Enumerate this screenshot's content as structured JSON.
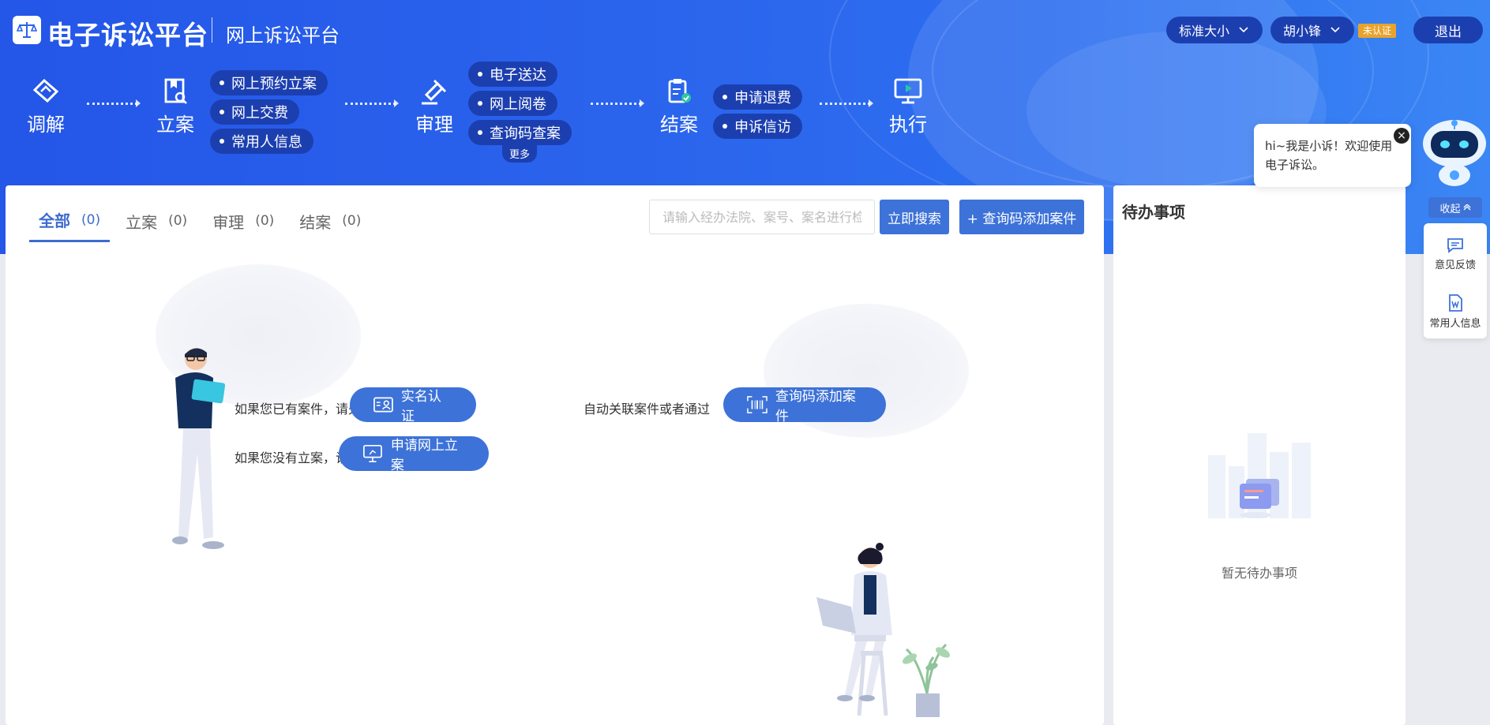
{
  "header": {
    "brand": "电子诉讼平台",
    "subtitle": "网上诉讼平台",
    "font_size_label": "标准大小",
    "user_name": "胡小锋",
    "auth_badge": "未认证",
    "logout_label": "退出"
  },
  "steps": [
    {
      "label": "调解",
      "icon": "handshake-icon"
    },
    {
      "label": "立案",
      "icon": "filing-icon"
    },
    {
      "label": "审理",
      "icon": "gavel-icon"
    },
    {
      "label": "结案",
      "icon": "clipboard-check-icon"
    },
    {
      "label": "执行",
      "icon": "monitor-play-icon"
    }
  ],
  "chips": {
    "filing": [
      "网上预约立案",
      "网上交费",
      "常用人信息"
    ],
    "trial": [
      "电子送达",
      "网上阅卷",
      "查询码查案"
    ],
    "trial_more": "更多",
    "closing": [
      "申请退费",
      "申诉信访"
    ]
  },
  "tabs": [
    {
      "label": "全部",
      "count": "(0)",
      "active": true
    },
    {
      "label": "立案",
      "count": "(0)",
      "active": false
    },
    {
      "label": "审理",
      "count": "(0)",
      "active": false
    },
    {
      "label": "结案",
      "count": "(0)",
      "active": false
    }
  ],
  "search": {
    "placeholder": "请输入经办法院、案号、案名进行检索",
    "button": "立即搜索",
    "add_button": "+ 查询码添加案件"
  },
  "guide": {
    "line1_prefix": "如果您已有案件，请先",
    "realname_button": "实名认证",
    "line1_mid": "自动关联案件或者通过",
    "querycode_button": "查询码添加案件",
    "line2_prefix": "如果您没有立案，请",
    "apply_button": "申请网上立案"
  },
  "todo": {
    "title": "待办事项",
    "empty_text": "暂无待办事项"
  },
  "assistant": {
    "greeting": "hi~我是小诉！欢迎使用电子诉讼。",
    "collapse_label": "收起",
    "tools": [
      {
        "label": "意见反馈",
        "icon": "feedback-icon"
      },
      {
        "label": "常用人信息",
        "icon": "document-icon"
      }
    ]
  },
  "colors": {
    "banner_blue": "#2a63ec",
    "accent": "#3d72d8",
    "chip_dark": "#1c3fb0",
    "badge_orange": "#e8a32c"
  }
}
